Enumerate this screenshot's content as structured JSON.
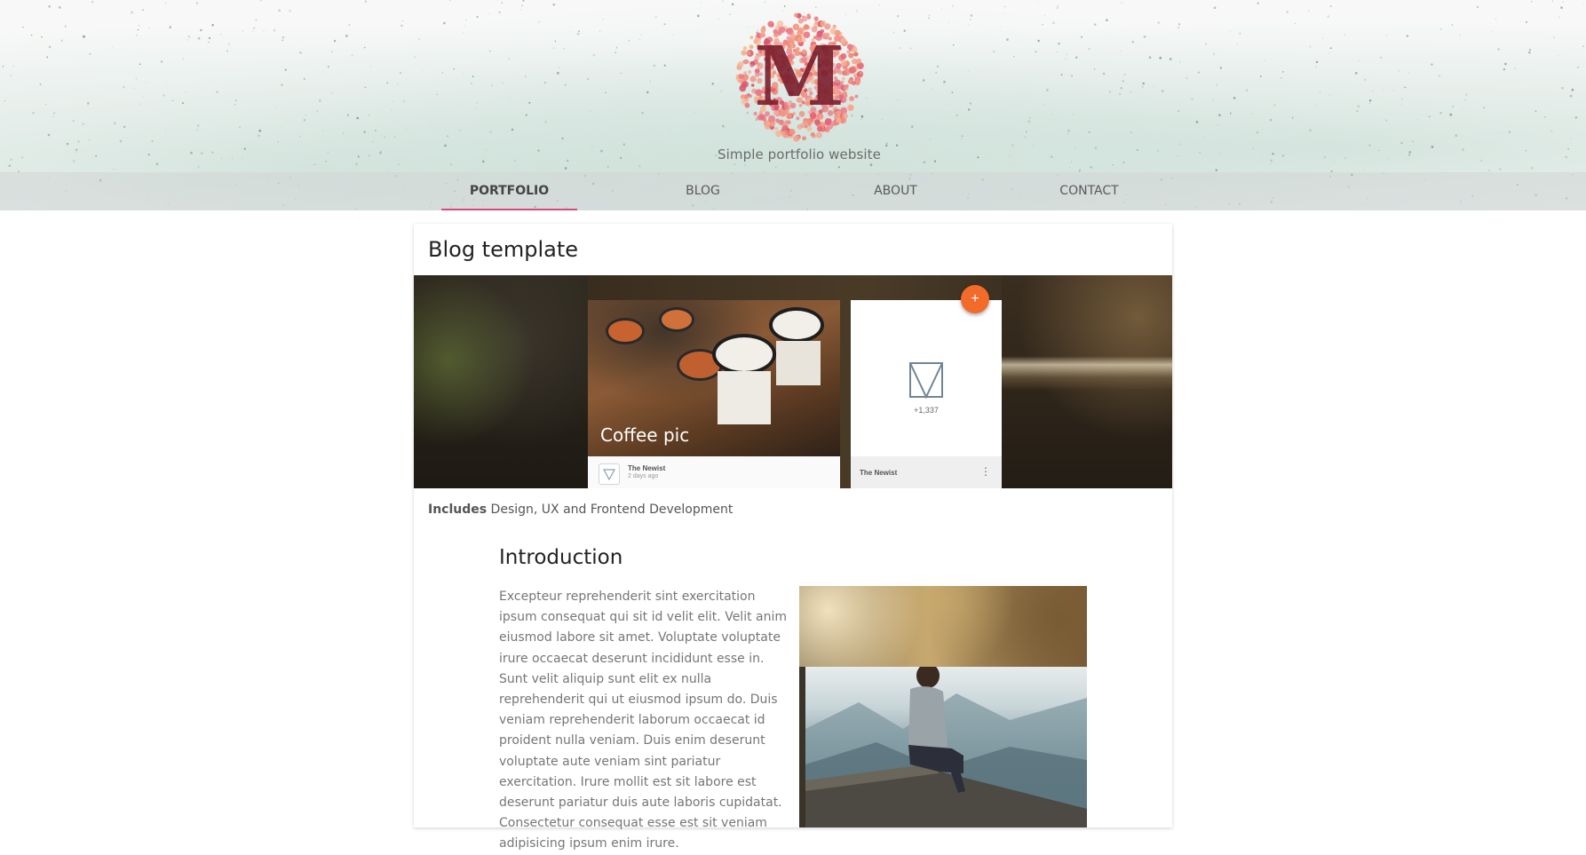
{
  "header": {
    "logo_letter": "M",
    "tagline": "Simple portfolio website"
  },
  "nav": {
    "items": [
      {
        "label": "PORTFOLIO",
        "active": true
      },
      {
        "label": "BLOG",
        "active": false
      },
      {
        "label": "ABOUT",
        "active": false
      },
      {
        "label": "CONTACT",
        "active": false
      }
    ]
  },
  "project": {
    "title": "Blog template",
    "hero": {
      "caption": "Coffee pic",
      "card_name": "The Newist",
      "card_time": "2 days ago",
      "right_card_count": "+1,337",
      "right_card_name": "The Newist",
      "fab_label": "+",
      "menu_glyph": "⋮"
    },
    "includes_label": "Includes",
    "includes_text": "Design, UX and Frontend Development",
    "intro": {
      "heading": "Introduction",
      "paragraph": "Excepteur reprehenderit sint exercitation ipsum consequat qui sit id velit elit. Velit anim eiusmod labore sit amet. Voluptate voluptate irure occaecat deserunt incididunt esse in. Sunt velit aliquip sunt elit ex nulla reprehenderit qui ut eiusmod ipsum do. Duis veniam reprehenderit laborum occaecat id proident nulla veniam. Duis enim deserunt voluptate aute veniam sint pariatur exercitation. Irure mollit est sit labore est deserunt pariatur duis aute laboris cupidatat. Consectetur consequat esse est sit veniam adipisicing ipsum enim irure."
    }
  },
  "colors": {
    "accent": "#e0457b",
    "fab": "#f26b2a",
    "nav_bar": "#d2d6d6",
    "text_muted": "#767676"
  },
  "icons": [
    "logo-m-dots",
    "plus-icon",
    "more-vert-icon",
    "newist-logo-icon"
  ]
}
